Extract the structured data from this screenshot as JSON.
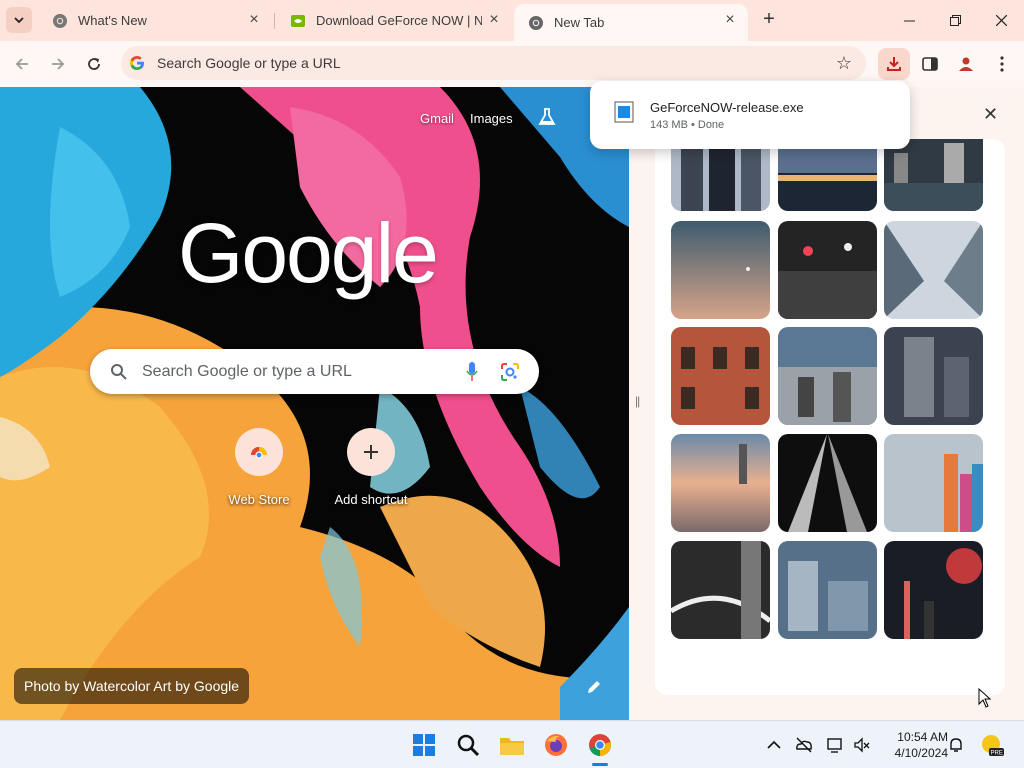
{
  "tabs": [
    {
      "title": "What's New",
      "active": false
    },
    {
      "title": "Download GeForce NOW | NVIDIA",
      "active": false
    },
    {
      "title": "New Tab",
      "active": true
    }
  ],
  "omnibox": {
    "placeholder": "Search Google or type a URL"
  },
  "ntp": {
    "links": {
      "gmail": "Gmail",
      "images": "Images"
    },
    "logo": "Google",
    "search_placeholder": "Search Google or type a URL",
    "shortcuts": [
      {
        "label": "Web Store"
      },
      {
        "label": "Add shortcut"
      }
    ],
    "attribution": "Photo by Watercolor Art by Google"
  },
  "download": {
    "filename": "GeForceNOW-release.exe",
    "status": "143 MB • Done"
  },
  "clock": {
    "time": "10:54 AM",
    "date": "4/10/2024"
  },
  "colors": {
    "accent": "#f0a895",
    "tab_strip": "#fde4dd",
    "toolbar": "#fff7f4"
  }
}
